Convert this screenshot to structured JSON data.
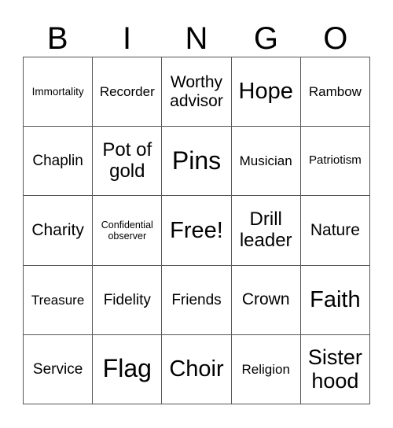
{
  "header": {
    "letters": [
      "B",
      "I",
      "N",
      "G",
      "O"
    ]
  },
  "cells": [
    "Immortality",
    "Recorder",
    "Worthy advisor",
    "Hope",
    "Rambow",
    "Chaplin",
    "Pot of gold",
    "Pins",
    "Musician",
    "Patriotism",
    "Charity",
    "Confidential observer",
    "Free!",
    "Drill leader",
    "Nature",
    "Treasure",
    "Fidelity",
    "Friends",
    "Crown",
    "Faith",
    "Service",
    "Flag",
    "Choir",
    "Religion",
    "Sister hood"
  ]
}
